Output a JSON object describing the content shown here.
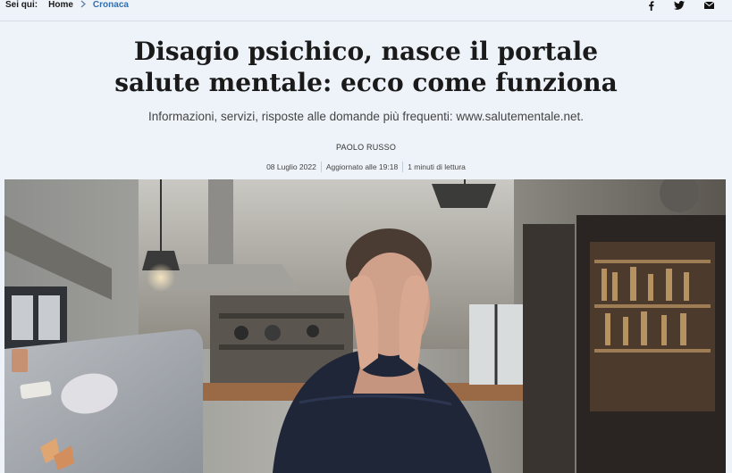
{
  "breadcrumb": {
    "label": "Sei qui:",
    "items": [
      "Home",
      "Cronaca"
    ]
  },
  "share": {
    "icons": [
      "facebook-icon",
      "twitter-icon",
      "mail-icon"
    ]
  },
  "article": {
    "title": "Disagio psichico, nasce il portale salute mentale: ecco come funziona",
    "subtitle": "Informazioni, servizi, risposte alle domande più frequenti: www.salutementale.net.",
    "author": "PAOLO RUSSO",
    "date": "08 Luglio 2022",
    "updated": "Aggiornato alle 19:18",
    "reading_time": "1 minuti di lettura"
  },
  "colors": {
    "background": "#eef3f9",
    "link": "#2f6fb0",
    "text": "#1a1a1a"
  }
}
